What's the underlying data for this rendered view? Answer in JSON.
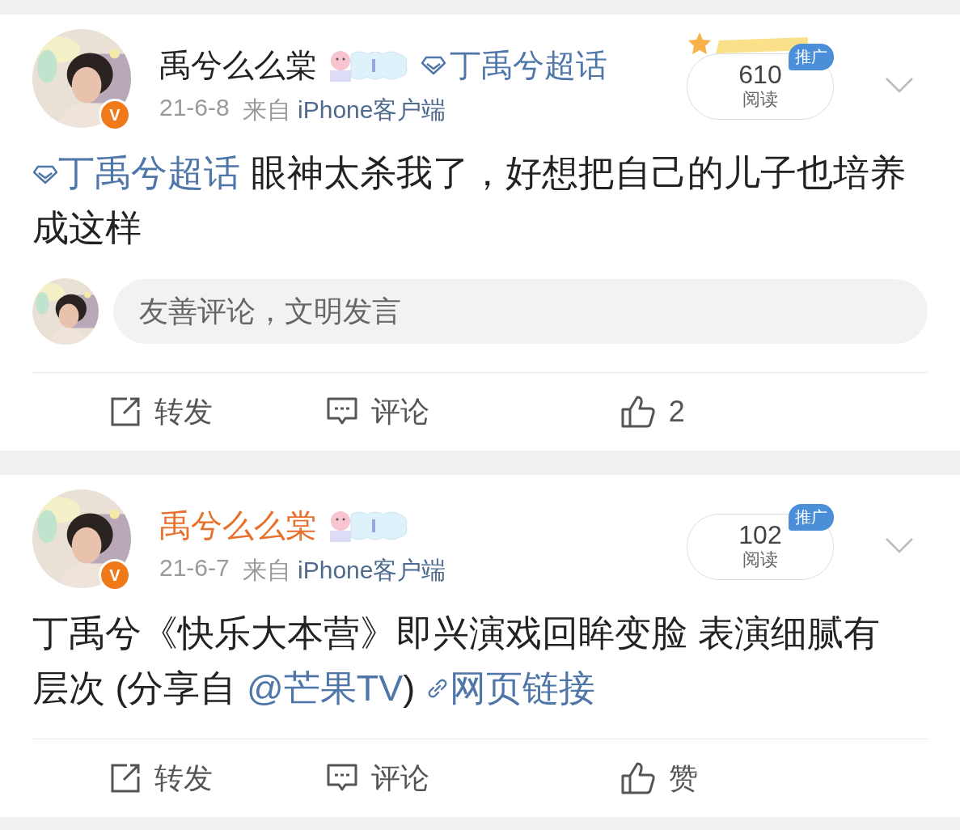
{
  "posts": [
    {
      "author": {
        "name": "禹兮么么棠",
        "color": "#222222",
        "verified_mark": "V"
      },
      "topic": "丁禹兮超话",
      "date": "21-6-8",
      "source_prefix": "来自",
      "source": "iPhone客户端",
      "reads": "610",
      "reads_label": "阅读",
      "promo": "推广",
      "promo_ribbon": true,
      "body": [
        {
          "kind": "topic",
          "text": "丁禹兮超话"
        },
        {
          "kind": "text",
          "text": " 眼神太杀我了，好想把自己的儿子也培养成这样"
        }
      ],
      "comment_box": {
        "placeholder": "友善评论，文明发言"
      },
      "actions": [
        {
          "kind": "repost",
          "label": "转发"
        },
        {
          "kind": "comment",
          "label": "评论"
        },
        {
          "kind": "like",
          "label": "2"
        }
      ]
    },
    {
      "author": {
        "name": "禹兮么么棠",
        "color": "#e8702a",
        "verified_mark": "V"
      },
      "date": "21-6-7",
      "source_prefix": "来自",
      "source": "iPhone客户端",
      "reads": "102",
      "reads_label": "阅读",
      "promo": "推广",
      "promo_ribbon": false,
      "body": [
        {
          "kind": "text",
          "text": "丁禹兮《快乐大本营》即兴演戏回眸变脸 表演细腻有层次 (分享自 "
        },
        {
          "kind": "mention",
          "text": "@芒果TV"
        },
        {
          "kind": "text",
          "text": ") "
        },
        {
          "kind": "link",
          "text": "网页链接"
        }
      ],
      "actions": [
        {
          "kind": "repost",
          "label": "转发"
        },
        {
          "kind": "comment",
          "label": "评论"
        },
        {
          "kind": "like",
          "label": "赞"
        }
      ]
    }
  ]
}
